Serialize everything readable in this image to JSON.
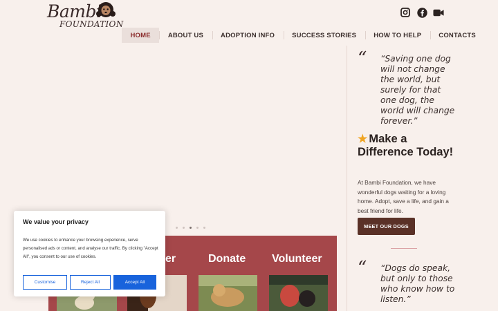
{
  "brand": {
    "name": "Bambi",
    "sub": "FOUNDATION"
  },
  "social": [
    {
      "icon": "instagram-icon"
    },
    {
      "icon": "facebook-icon"
    },
    {
      "icon": "video-camera-icon"
    }
  ],
  "nav": [
    {
      "label": "HOME",
      "active": true
    },
    {
      "label": "ABOUT US"
    },
    {
      "label": "ADOPTION INFO"
    },
    {
      "label": "SUCCESS STORIES"
    },
    {
      "label": "HOW TO HELP"
    },
    {
      "label": "CONTACTS"
    }
  ],
  "slider": {
    "dot_count": 5,
    "active_index": 2
  },
  "cards": [
    {
      "title": "er"
    },
    {
      "title": "Donate"
    },
    {
      "title": "Volunteer"
    }
  ],
  "sidebar": {
    "quote1": "“Saving one dog will not change the world, but surely for that one dog, the world will change forever.”",
    "heading": "Make a Difference Today!",
    "text": "At Bambi Foundation, we have wonderful dogs waiting for a loving home. Adopt, save a life, and gain a best friend for life.",
    "button": "MEET OUR DOGS",
    "quote2": "“Dogs do speak, but only to those who know how to listen.”"
  },
  "cookie": {
    "title": "We value your privacy",
    "text": "We use cookies to enhance your browsing experience, serve personalised ads or content, and analyse our traffic. By clicking \"Accept All\", you consent to our use of cookies.",
    "customise": "Customise",
    "reject": "Reject All",
    "accept": "Accept All"
  },
  "colors": {
    "accent": "#a5474a",
    "button": "#5a3127",
    "cookie_primary": "#1863dc",
    "background": "#f8f0ec"
  }
}
